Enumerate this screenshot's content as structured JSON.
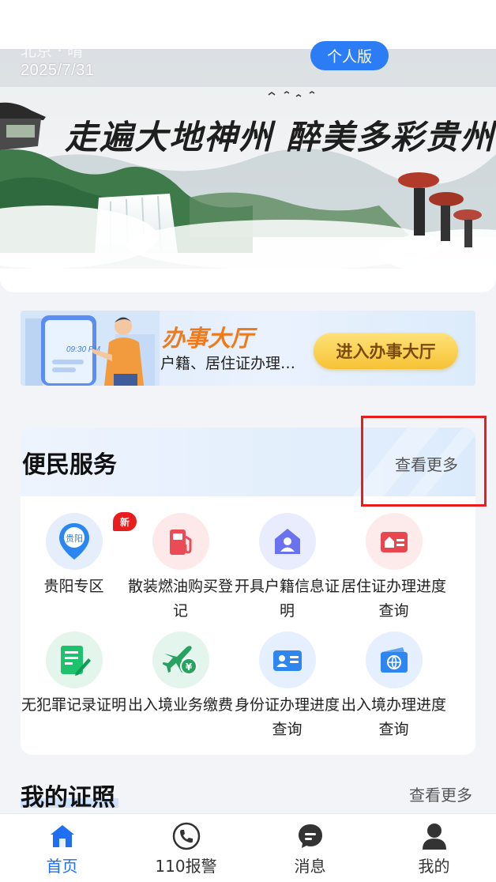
{
  "banner": {
    "weather": "北京 · 晴",
    "date": "2025/7/31",
    "version_label": "个人版",
    "slogan": "走遍大地神州  醉美多彩贵州"
  },
  "hall": {
    "title": "办事大厅",
    "subtitle": "户籍、居住证办理…",
    "button_label": "进入办事大厅",
    "phone_time": "09:30 PM"
  },
  "services": {
    "title": "便民服务",
    "more_label": "查看更多",
    "items": [
      {
        "label": "贵阳专区",
        "icon": "guiyang-location-icon",
        "badge": "新"
      },
      {
        "label": "散装燃油购买登记",
        "icon": "fuel-pump-icon"
      },
      {
        "label": "开具户籍信息证明",
        "icon": "household-icon"
      },
      {
        "label": "居住证办理进度查询",
        "icon": "residence-card-icon"
      },
      {
        "label": "无犯罪记录证明",
        "icon": "document-edit-icon"
      },
      {
        "label": "出入境业务缴费",
        "icon": "plane-payment-icon"
      },
      {
        "label": "身份证办理进度查询",
        "icon": "id-card-icon"
      },
      {
        "label": "出入境办理进度查询",
        "icon": "passport-icon"
      }
    ],
    "colors": {
      "accent": "#1f6ff2",
      "highlight": "#e81d1d"
    }
  },
  "licences": {
    "title": "我的证照",
    "more_label": "查看更多"
  },
  "tabbar": {
    "items": [
      {
        "label": "首页",
        "icon": "home-icon",
        "active": true
      },
      {
        "label": "110报警",
        "icon": "phone-icon",
        "active": false
      },
      {
        "label": "消息",
        "icon": "message-icon",
        "active": false
      },
      {
        "label": "我的",
        "icon": "user-icon",
        "active": false
      }
    ]
  }
}
